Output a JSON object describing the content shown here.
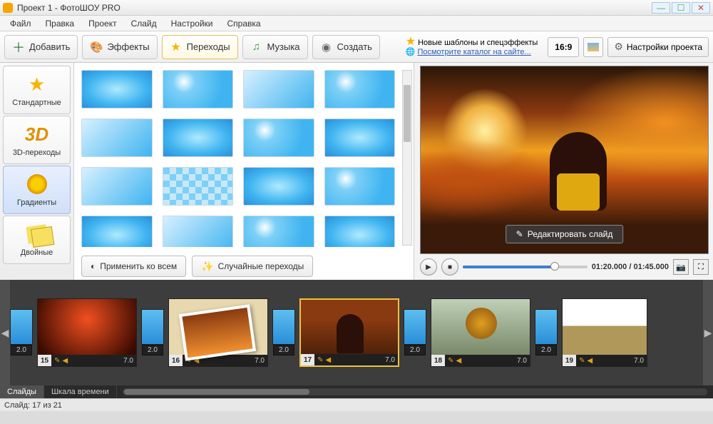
{
  "window": {
    "title": "Проект 1 - ФотоШОУ PRO"
  },
  "menu": {
    "file": "Файл",
    "edit": "Правка",
    "project": "Проект",
    "slide": "Слайд",
    "settings": "Настройки",
    "help": "Справка"
  },
  "toolbar": {
    "add": "Добавить",
    "effects": "Эффекты",
    "transitions": "Переходы",
    "music": "Музыка",
    "create": "Создать",
    "promo_line1": "Новые шаблоны и спецэффекты",
    "promo_line2": "Посмотрите каталог на сайте...",
    "ratio": "16:9",
    "project_settings": "Настройки проекта"
  },
  "sidebar": {
    "standard": "Стандартные",
    "threeD": "3D-переходы",
    "gradients": "Градиенты",
    "double": "Двойные"
  },
  "gallery_actions": {
    "apply_all": "Применить ко всем",
    "random": "Случайные переходы"
  },
  "preview": {
    "edit_slide": "Редактировать слайд",
    "time_current": "01:20.000",
    "time_total": "01:45.000"
  },
  "timeline": {
    "slides": [
      {
        "index": "15",
        "duration": "7.0",
        "trans_before": "2.0"
      },
      {
        "index": "16",
        "duration": "7.0",
        "trans_before": "2.0"
      },
      {
        "index": "17",
        "duration": "7.0",
        "trans_before": "2.0",
        "selected": true
      },
      {
        "index": "18",
        "duration": "7.0",
        "trans_before": "2.0"
      },
      {
        "index": "19",
        "duration": "7.0",
        "trans_before": "2.0"
      }
    ],
    "tab_slides": "Слайды",
    "tab_timescale": "Шкала времени"
  },
  "status": {
    "text": "Слайд: 17 из 21"
  }
}
